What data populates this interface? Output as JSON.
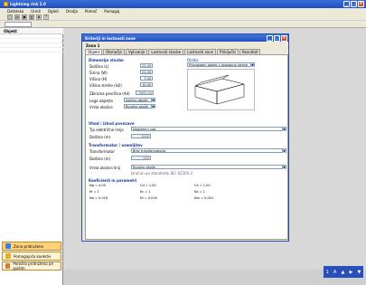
{
  "app": {
    "title": "Lightning risk 2.0"
  },
  "menu": [
    "Datoteka",
    "Uredi",
    "Ogled",
    "Orodja",
    "Pomoč",
    "Pomagaj"
  ],
  "toolbar": {
    "icons": [
      "new",
      "open",
      "save",
      "print",
      "preview",
      "help"
    ]
  },
  "sidebar": {
    "header": "Objekt"
  },
  "nav": [
    {
      "label": "Zone pridružene"
    },
    {
      "label": "Pomagajoče korektiv"
    },
    {
      "label": "Poročilo pridruženo pri spidim"
    }
  ],
  "tray": [
    "1",
    "A",
    "▲",
    "▶",
    "▼"
  ],
  "dialog": {
    "title": "Kriteriji in lastnosti zone",
    "zone_label": "Zona 1",
    "tabs": [
      "Objekt",
      "Območje",
      "Vplivanje",
      "Lastnosti stavbe",
      "Lastnosti zone",
      "Priključki",
      "Rezultati"
    ],
    "dims_title": "Dimenzije stavbe",
    "dims": [
      {
        "label": "Dolžina (L)",
        "value": "22.00"
      },
      {
        "label": "Širina (W)",
        "value": "22.00"
      },
      {
        "label": "Višina (H)",
        "value": "7.00"
      },
      {
        "label": "Višina strehe (H2)",
        "value": "10.00"
      },
      {
        "label": "Zbiralna površina (Ad)",
        "value": "3952.44"
      }
    ],
    "location": {
      "label": "Lega objekta",
      "value": "Izoliran objekt"
    },
    "environment": {
      "label": "Vrsta okolice",
      "value": "Ruralno okolje"
    },
    "shape": {
      "label": "Oblika",
      "value": "Pravokoten objekt z dvokapno streho"
    },
    "lines_title": "Vhod / izhod povezave",
    "line1": {
      "label": "Tip električne linije",
      "value": "Nadzemni vod"
    },
    "length1": {
      "label": "Dolžina (m)",
      "value": "1000"
    },
    "grid_title": "Transformator / ozemljitev",
    "trafo": {
      "label": "Transformator",
      "value": "Brez transformatorja"
    },
    "length2": {
      "label": "Dolžina (m)",
      "value": "500"
    },
    "env2": {
      "label": "Vrsta okolice linij",
      "value": "Ruralno okolje"
    },
    "risk_title": "Koeficienti in parametri",
    "facts": [
      [
        "Ng = 4.00",
        "Cd = 1.00",
        "Ce = 1.00"
      ],
      [
        "Kf = 1",
        "Kc = 1",
        "Kd = 1"
      ],
      [
        "Nd = 0.016",
        "Nl = 0.016",
        "Nm = 0.001"
      ]
    ],
    "note": "Izračun po standardu IEC 62305-2"
  }
}
